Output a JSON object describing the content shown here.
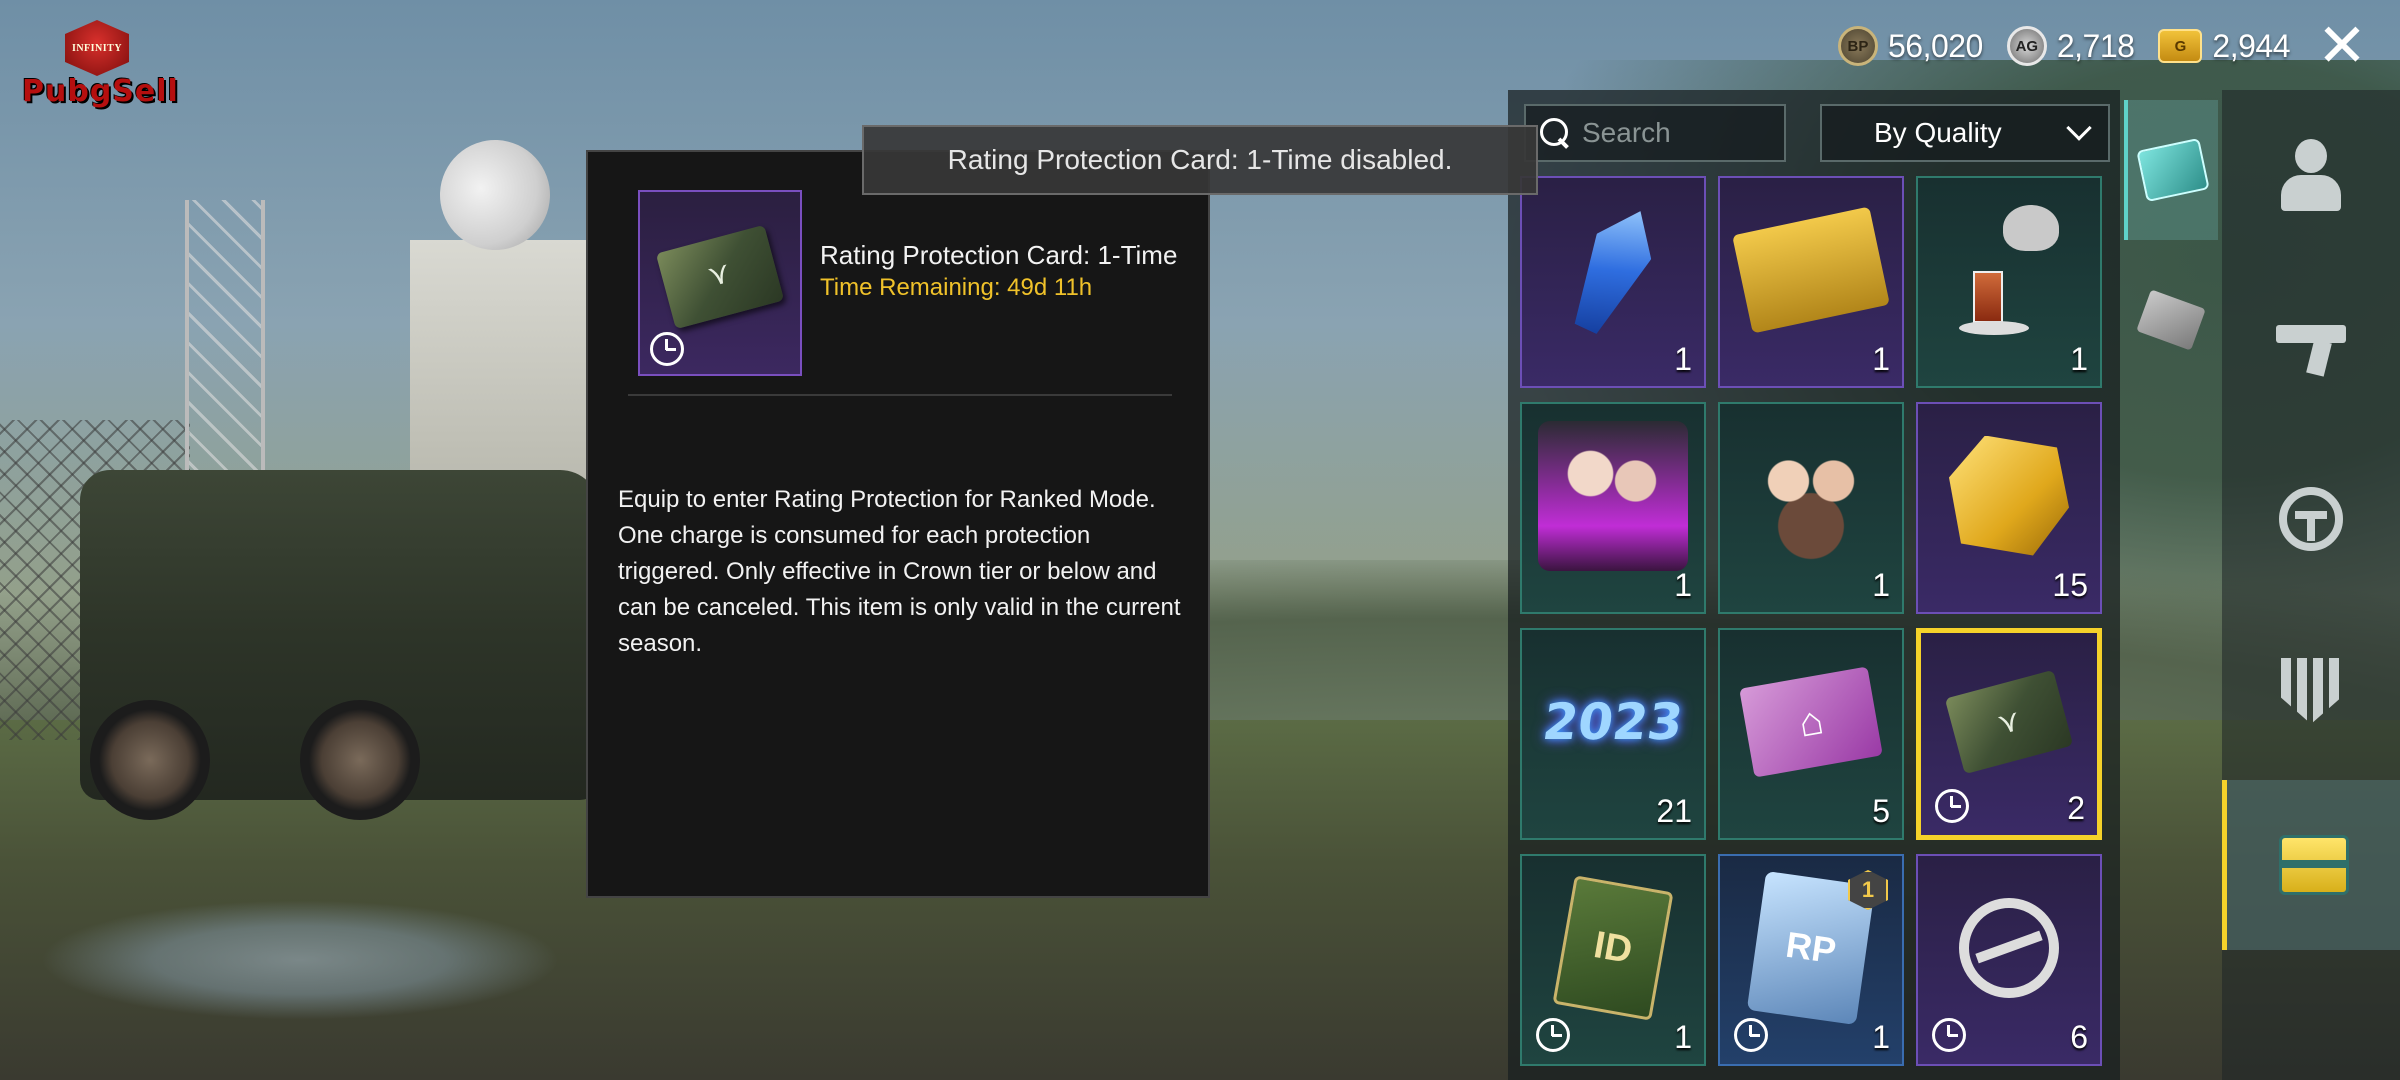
{
  "logo": {
    "badge_text": "INFINITY",
    "wordmark": "PubgSell"
  },
  "currency": {
    "bp": {
      "icon": "bp-coin-icon",
      "symbol": "BP",
      "value": "56,020"
    },
    "ag": {
      "icon": "ag-coin-icon",
      "symbol": "AG",
      "value": "2,718"
    },
    "uc": {
      "icon": "g-coin-icon",
      "symbol": "G",
      "value": "2,944"
    },
    "close_glyph": "✕"
  },
  "toast": {
    "message": "Rating Protection Card: 1-Time disabled."
  },
  "detail": {
    "item_name": "Rating Protection Card: 1-Time",
    "time_remaining": "Time Remaining: 49d 11h",
    "description": "Equip to enter Rating Protection for Ranked Mode. One charge is consumed for each protection triggered. Only effective in Crown tier or below and can be canceled. This item is only valid in the current season."
  },
  "inventory": {
    "search_placeholder": "Search",
    "sort_label": "By Quality",
    "items": [
      {
        "name": "blue-crystal",
        "count": "1",
        "quality": "purple",
        "timed": false
      },
      {
        "name": "gold-ticket",
        "count": "1",
        "quality": "purple",
        "timed": false
      },
      {
        "name": "tea-set",
        "count": "1",
        "quality": "teal",
        "timed": false
      },
      {
        "name": "character-emote",
        "count": "1",
        "quality": "teal",
        "timed": false
      },
      {
        "name": "party-emote",
        "count": "1",
        "quality": "teal",
        "timed": false
      },
      {
        "name": "gold-fragment",
        "count": "15",
        "quality": "purple",
        "timed": false
      },
      {
        "name": "2023-fireworks",
        "count": "21",
        "quality": "teal",
        "timed": false,
        "art_text": "2023"
      },
      {
        "name": "home-card",
        "count": "5",
        "quality": "teal",
        "timed": false,
        "art_text": "⌂"
      },
      {
        "name": "rating-protection-card",
        "count": "2",
        "quality": "purple",
        "timed": true,
        "selected": true
      },
      {
        "name": "id-card",
        "count": "1",
        "quality": "teal",
        "timed": true,
        "art_text": "ID"
      },
      {
        "name": "rp-card",
        "count": "1",
        "quality": "blue",
        "timed": true,
        "art_text": "RP",
        "badge": "1"
      },
      {
        "name": "swap-token",
        "count": "6",
        "quality": "purple",
        "timed": true
      }
    ]
  },
  "categories": [
    {
      "icon": "supply-box-icon",
      "active": true
    },
    {
      "icon": "card-icon",
      "active": false
    }
  ],
  "nav": [
    {
      "icon": "character-icon",
      "active": false
    },
    {
      "icon": "weapon-icon",
      "active": false
    },
    {
      "icon": "vehicle-wheel-icon",
      "active": false
    },
    {
      "icon": "emblem-icon",
      "active": false
    },
    {
      "icon": "inventory-crate-icon",
      "active": true
    }
  ],
  "colors": {
    "accent": "#f5d22a",
    "time_remaining": "#f0c22a",
    "teal_active": "#5fd3c9"
  }
}
